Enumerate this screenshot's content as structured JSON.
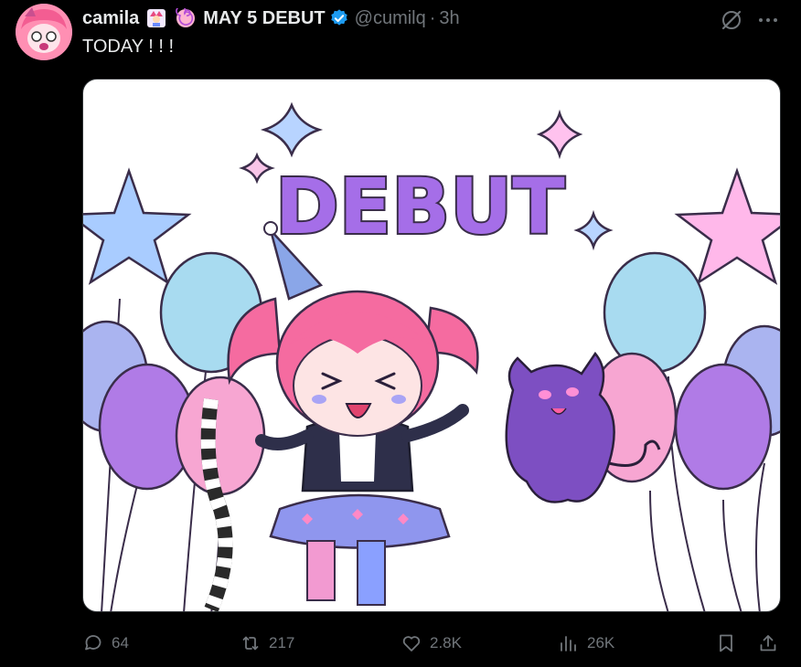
{
  "tweet": {
    "author_name": "camila",
    "display_suffix": "MAY 5 DEBUT",
    "handle": "@cumilq",
    "separator": "·",
    "time": "3h",
    "text": "TODAY ! ! !"
  },
  "media": {
    "debut_text": "DEBUT"
  },
  "actions": {
    "replies": "64",
    "reposts": "217",
    "likes": "2.8K",
    "views": "26K"
  },
  "colors": {
    "background": "#000000",
    "text_primary": "#e7e9ea",
    "text_secondary": "#71767b",
    "verified": "#1d9bf0",
    "debut_purple": "#a56ee8"
  },
  "icons": [
    "grok-icon",
    "more-icon",
    "reply-icon",
    "repost-icon",
    "like-icon",
    "views-icon",
    "bookmark-icon",
    "share-icon",
    "verified-icon"
  ]
}
